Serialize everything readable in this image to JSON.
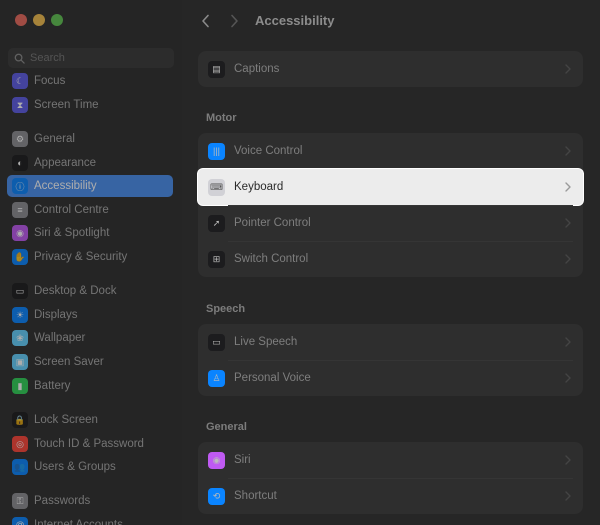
{
  "window": {
    "title": "Accessibility"
  },
  "search": {
    "placeholder": "Search"
  },
  "sidebar": {
    "items": [
      {
        "label": "Focus",
        "icon": "focus-icon",
        "color": "#5e5ce6"
      },
      {
        "label": "Screen Time",
        "icon": "hourglass-icon",
        "color": "#5e5ce6"
      },
      {
        "label": "General",
        "icon": "gear-icon",
        "color": "#8e8e93"
      },
      {
        "label": "Appearance",
        "icon": "appearance-icon",
        "color": "#1c1c1e"
      },
      {
        "label": "Accessibility",
        "icon": "accessibility-icon",
        "color": "#0a84ff",
        "selected": true
      },
      {
        "label": "Control Centre",
        "icon": "control-centre-icon",
        "color": "#8e8e93"
      },
      {
        "label": "Siri & Spotlight",
        "icon": "siri-icon",
        "color": "#bf5af2"
      },
      {
        "label": "Privacy & Security",
        "icon": "hand-icon",
        "color": "#0a84ff"
      },
      {
        "label": "Desktop & Dock",
        "icon": "dock-icon",
        "color": "#1c1c1e"
      },
      {
        "label": "Displays",
        "icon": "display-icon",
        "color": "#0a84ff"
      },
      {
        "label": "Wallpaper",
        "icon": "wallpaper-icon",
        "color": "#64d2ff"
      },
      {
        "label": "Screen Saver",
        "icon": "screen-saver-icon",
        "color": "#64d2ff"
      },
      {
        "label": "Battery",
        "icon": "battery-icon",
        "color": "#30d158"
      },
      {
        "label": "Lock Screen",
        "icon": "lock-icon",
        "color": "#1c1c1e"
      },
      {
        "label": "Touch ID & Password",
        "icon": "fingerprint-icon",
        "color": "#ff453a"
      },
      {
        "label": "Users & Groups",
        "icon": "users-icon",
        "color": "#0a84ff"
      },
      {
        "label": "Passwords",
        "icon": "key-icon",
        "color": "#8e8e93"
      },
      {
        "label": "Internet Accounts",
        "icon": "at-icon",
        "color": "#0a84ff"
      }
    ]
  },
  "main": {
    "sections": [
      {
        "title": "",
        "rows": [
          {
            "label": "Captions",
            "icon": "captions-icon",
            "color": "#1c1c1e"
          }
        ]
      },
      {
        "title": "Motor",
        "rows": [
          {
            "label": "Voice Control",
            "icon": "voice-control-icon",
            "color": "#0a84ff"
          },
          {
            "label": "Keyboard",
            "icon": "keyboard-icon",
            "color": "#d1d1d6",
            "highlighted": true
          },
          {
            "label": "Pointer Control",
            "icon": "pointer-icon",
            "color": "#1c1c1e"
          },
          {
            "label": "Switch Control",
            "icon": "switch-control-icon",
            "color": "#1c1c1e"
          }
        ]
      },
      {
        "title": "Speech",
        "rows": [
          {
            "label": "Live Speech",
            "icon": "live-speech-icon",
            "color": "#1c1c1e"
          },
          {
            "label": "Personal Voice",
            "icon": "personal-voice-icon",
            "color": "#0a84ff"
          }
        ]
      },
      {
        "title": "General",
        "rows": [
          {
            "label": "Siri",
            "icon": "siri-icon",
            "color": "#bf5af2"
          },
          {
            "label": "Shortcut",
            "icon": "shortcut-icon",
            "color": "#0a84ff"
          }
        ]
      }
    ]
  },
  "colors": {
    "accent": "#4a8ff0",
    "highlight_row": "#ececec"
  }
}
